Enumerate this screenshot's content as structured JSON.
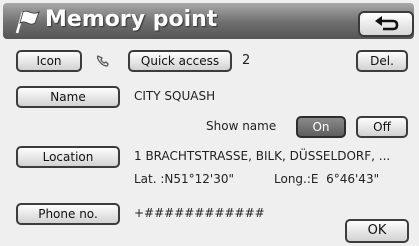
{
  "header": {
    "title": "Memory point",
    "flag_icon": "flag-icon",
    "back_icon": "return-arrow-icon"
  },
  "row_icon": {
    "icon_label": "Icon",
    "phone_icon": "phone-icon",
    "quick_access_label": "Quick access",
    "quick_access_value": "2",
    "delete_label": "Del."
  },
  "row_name": {
    "name_label": "Name",
    "name_value": "CITY SQUASH",
    "show_name_label": "Show name",
    "on_label": "On",
    "off_label": "Off",
    "selected": "On"
  },
  "row_location": {
    "location_label": "Location",
    "address": "1 BRACHTSTRASSE, BILK, DÜSSELDORF, ...",
    "lat": "Lat. :N51°12'30\"",
    "long": "Long.:E  6°46'43\""
  },
  "row_phone": {
    "phone_label": "Phone no.",
    "phone_value": "+############"
  },
  "footer": {
    "ok_label": "OK"
  }
}
